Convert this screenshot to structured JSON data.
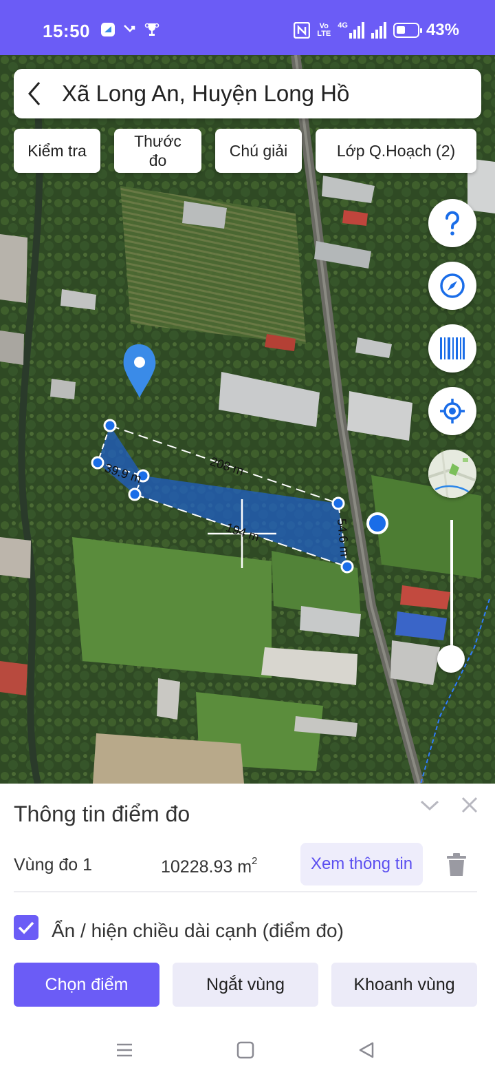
{
  "status_bar": {
    "time": "15:50",
    "volte_top": "Vo",
    "volte_bottom": "LTE",
    "network": "4G",
    "battery_percent": "43%",
    "battery_level": 0.43
  },
  "header": {
    "title": "Xã Long An, Huyện Long Hồ"
  },
  "toolbar": {
    "check_label": "Kiểm tra",
    "ruler_label_line1": "Thước",
    "ruler_label_line2": "đo",
    "legend_label": "Chú giải",
    "layers_label": "Lớp Q.Hoạch (2)"
  },
  "map": {
    "measure_labels": {
      "top_edge": "208 m",
      "left_edge": "39.9 m",
      "bottom_edge": "194 m",
      "right_edge": "54.6 m"
    },
    "colors": {
      "polygon_fill": "#1e5fd0",
      "vertex": "#1a6de8",
      "accent": "#6b5cf6"
    }
  },
  "sheet": {
    "title": "Thông tin điểm đo",
    "region_label": "Vùng đo 1",
    "area_value": "10228.93 m",
    "area_unit_sup": "2",
    "view_info_label": "Xem thông tin",
    "toggle_label": "Ẩn / hiện chiều dài cạnh (điểm đo)",
    "toggle_checked": true,
    "buttons": {
      "select_point": "Chọn điểm",
      "break_region": "Ngắt vùng",
      "enclose_region": "Khoanh vùng"
    }
  }
}
